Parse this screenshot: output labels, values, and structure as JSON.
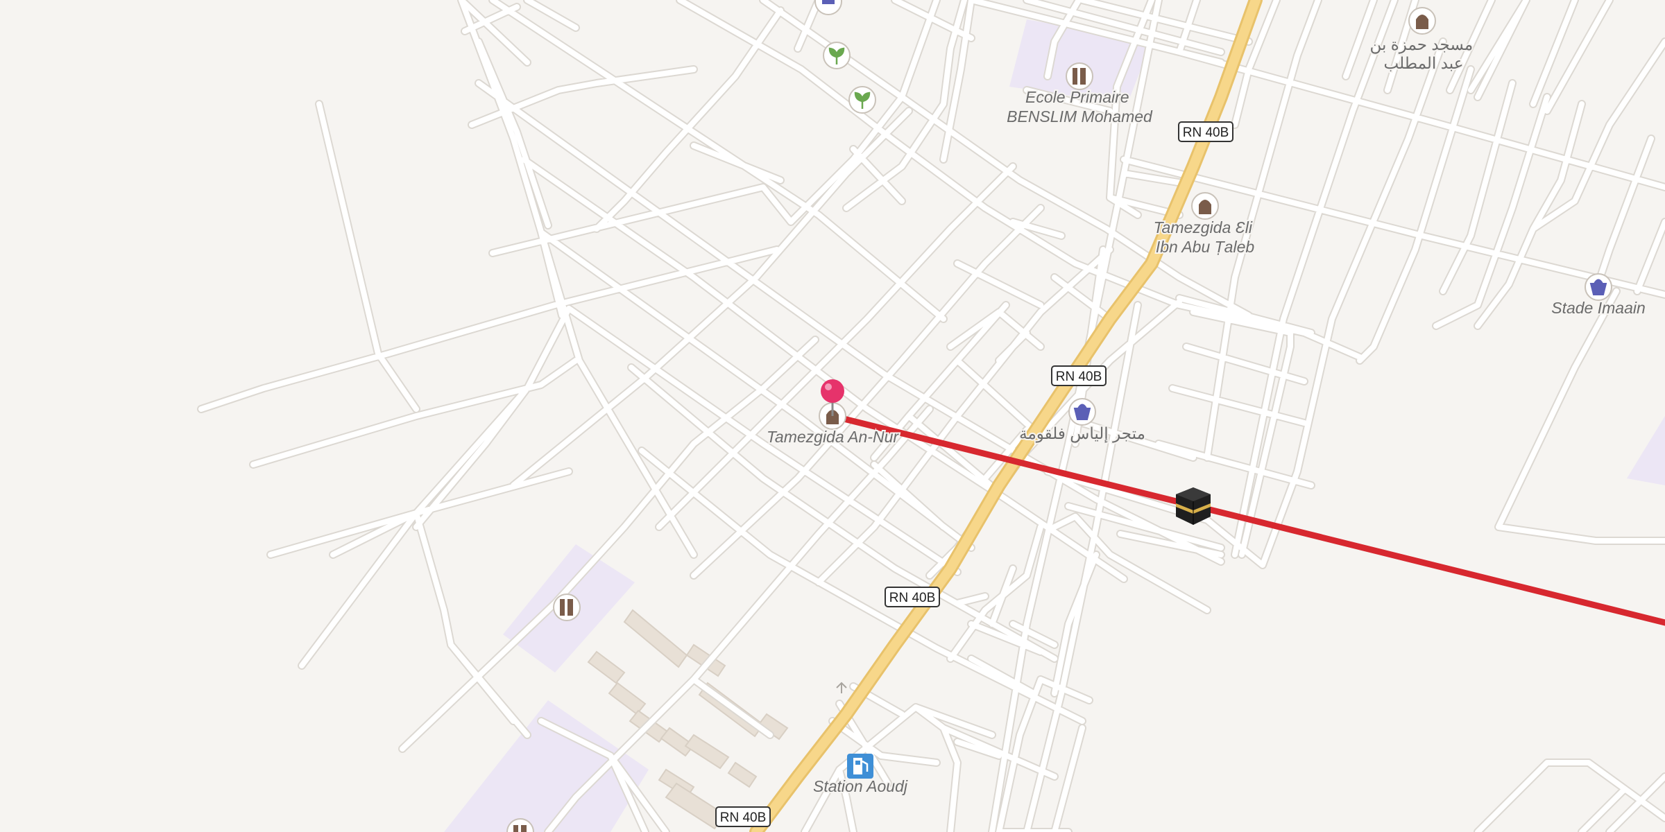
{
  "map": {
    "colors": {
      "land": "#f6f4f1",
      "road": "#ffffff",
      "road_casing": "#dcd8d2",
      "primary_road": "#f7d78a",
      "primary_casing": "#e8c26b",
      "school_area": "#ece6f5",
      "building": "#e8e0d6",
      "building_edge": "#d8cfc4",
      "route_line": "#d7282f",
      "pin": "#e6336b",
      "label_text": "#6b6b6b",
      "poi_brown": "#7a5c4a",
      "poi_blue": "#5b5fb6",
      "poi_green": "#6aa84f",
      "fuel_blue": "#3f8fd6"
    },
    "road_shields": [
      "RN 40B",
      "RN 40B",
      "RN 40B",
      "RN 40B"
    ],
    "pois": [
      {
        "id": "school-benslim",
        "icon": "school-icon",
        "label": "Ecole Primaire\nBENSLIM Mohamed"
      },
      {
        "id": "mosque-hamza",
        "icon": "mosque-icon",
        "label": "مسجد حمزة بن\nعبد المطلب"
      },
      {
        "id": "mosque-ali",
        "icon": "mosque-icon",
        "label": "Tamezgida Ɛli\nIbn Abu Ṭaleb"
      },
      {
        "id": "stade",
        "icon": "shop-icon",
        "label": "Stade Imaain"
      },
      {
        "id": "shop-elyas",
        "icon": "shop-icon",
        "label": "متجر إلياس فلقومة"
      },
      {
        "id": "mosque-annur",
        "icon": "mosque-icon",
        "label": "Tamezgida An-Nur"
      },
      {
        "id": "fuel-aoudj",
        "icon": "fuel-icon",
        "label": "Station Aoudj"
      },
      {
        "id": "school-sw",
        "icon": "school-icon",
        "label": ""
      },
      {
        "id": "garden-1",
        "icon": "garden-icon",
        "label": ""
      },
      {
        "id": "garden-2",
        "icon": "garden-icon",
        "label": ""
      },
      {
        "id": "shop-top",
        "icon": "shop-icon",
        "label": ""
      }
    ],
    "markers": [
      {
        "id": "selected-location",
        "icon": "map-pin-icon"
      },
      {
        "id": "qibla-kaaba",
        "icon": "kaaba-icon"
      }
    ]
  }
}
